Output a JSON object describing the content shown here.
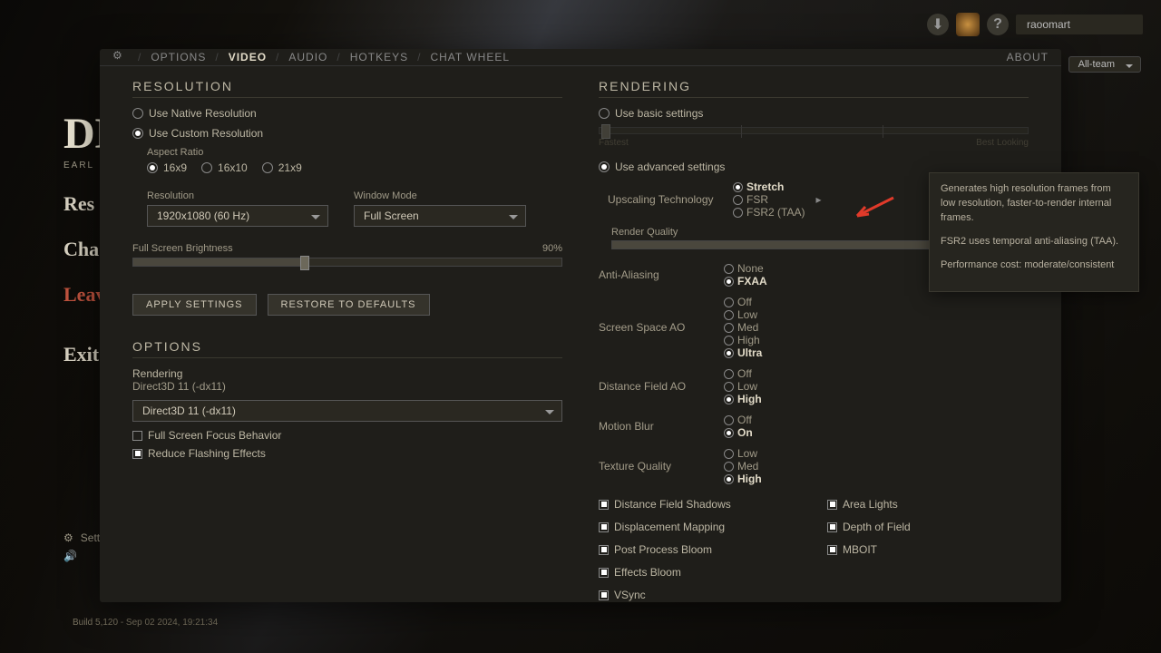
{
  "header": {
    "username": "raoomart",
    "chat_channel": "All-team"
  },
  "bg_menu": {
    "title": "DE",
    "subtitle": "EARL",
    "resume": "Res",
    "change": "Cha",
    "leave": "Leav",
    "exit": "Exit G",
    "settings": "Sett"
  },
  "build_info": "Build 5,120 - Sep 02 2024, 19:21:34",
  "tabs": {
    "options": "OPTIONS",
    "video": "VIDEO",
    "audio": "AUDIO",
    "hotkeys": "HOTKEYS",
    "chatwheel": "CHAT WHEEL",
    "about": "ABOUT"
  },
  "resolution": {
    "heading": "RESOLUTION",
    "native": "Use Native Resolution",
    "custom": "Use Custom Resolution",
    "aspect_label": "Aspect Ratio",
    "aspect_options": [
      "16x9",
      "16x10",
      "21x9"
    ],
    "aspect_selected": "16x9",
    "res_label": "Resolution",
    "res_value": "1920x1080 (60 Hz)",
    "window_label": "Window Mode",
    "window_value": "Full Screen",
    "brightness_label": "Full Screen Brightness",
    "brightness_value": "90%",
    "brightness_pct": 40,
    "apply": "APPLY SETTINGS",
    "restore": "RESTORE TO DEFAULTS"
  },
  "options": {
    "heading": "OPTIONS",
    "rendering_label": "Rendering",
    "rendering_sub": "Direct3D 11 (-dx11)",
    "rendering_value": "Direct3D 11 (-dx11)",
    "focus": "Full Screen Focus Behavior",
    "reduce_flash": "Reduce Flashing Effects"
  },
  "rendering": {
    "heading": "RENDERING",
    "basic": "Use basic settings",
    "basic_left": "Fastest",
    "basic_right": "Best Looking",
    "advanced": "Use advanced settings",
    "upscale_label": "Upscaling Technology",
    "upscale_options": [
      "Stretch",
      "FSR",
      "FSR2 (TAA)"
    ],
    "upscale_selected": "Stretch",
    "render_q_label": "Render Quality",
    "render_q_pct": 92,
    "aa_label": "Anti-Aliasing",
    "aa_options": [
      "None",
      "FXAA"
    ],
    "aa_selected": "FXAA",
    "ssao_label": "Screen Space AO",
    "ssao_options": [
      "Off",
      "Low",
      "Med",
      "High",
      "Ultra"
    ],
    "ssao_selected": "Ultra",
    "dfao_label": "Distance Field AO",
    "dfao_options": [
      "Off",
      "Low",
      "High"
    ],
    "dfao_selected": "High",
    "mblur_label": "Motion Blur",
    "mblur_options": [
      "Off",
      "On"
    ],
    "mblur_selected": "On",
    "tex_label": "Texture Quality",
    "tex_options": [
      "Low",
      "Med",
      "High"
    ],
    "tex_selected": "High",
    "checks_left": [
      "Distance Field Shadows",
      "Displacement Mapping",
      "Post Process Bloom",
      "Effects Bloom",
      "VSync"
    ],
    "checks_right": [
      "Area Lights",
      "Depth of Field",
      "MBOIT"
    ]
  },
  "tooltip": {
    "p1": "Generates high resolution frames from low resolution, faster-to-render internal frames.",
    "p2": "FSR2 uses temporal anti-aliasing (TAA).",
    "p3": "Performance cost: moderate/consistent"
  }
}
